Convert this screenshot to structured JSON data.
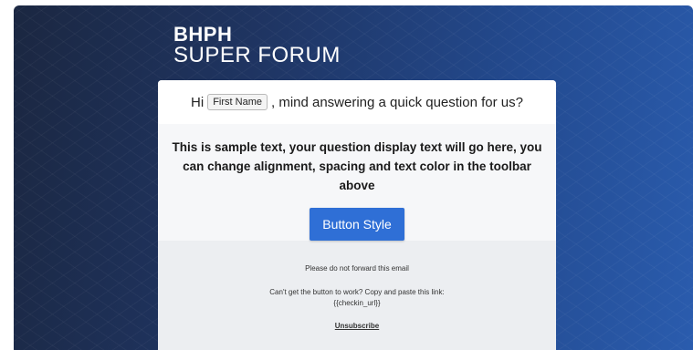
{
  "brand": {
    "line1": "BHPH",
    "line2": "SUPER FORUM"
  },
  "greeting": {
    "prefix": "Hi",
    "merge_tag": "First Name",
    "suffix": ", mind answering a quick question for us?"
  },
  "question": {
    "text": "This is sample text, your question display text will go here, you can change alignment, spacing and text color in the toolbar above",
    "button_label": "Button Style"
  },
  "footer": {
    "no_forward": "Please do not forward this email",
    "link_help": "Can't get the button to work? Copy and paste this link:",
    "link_placeholder": "{{checkin_url}}",
    "unsubscribe": "Unsubscribe"
  },
  "colors": {
    "button": "#2f6fd6",
    "background_dark": "#1b2741",
    "background_light": "#2a5cae"
  }
}
